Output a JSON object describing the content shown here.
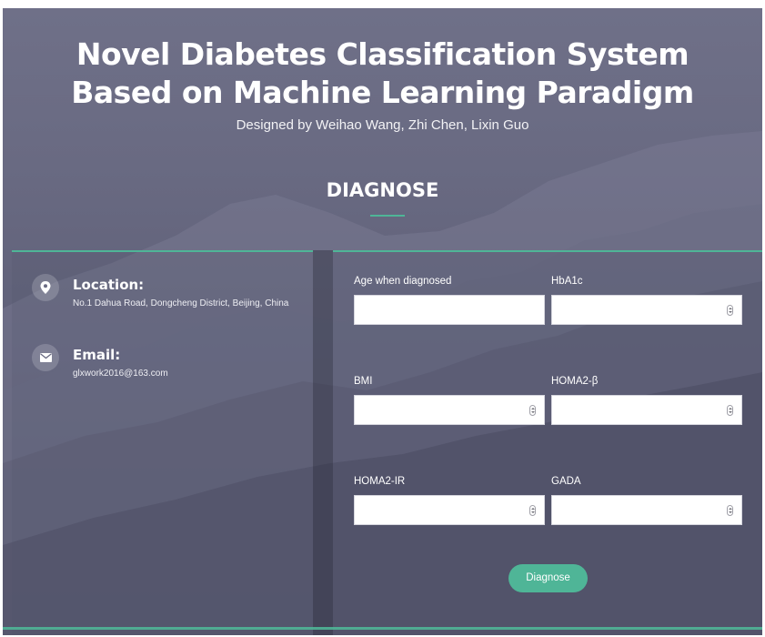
{
  "header": {
    "title_line1": "Novel Diabetes Classification System",
    "title_line2": "Based on Machine Learning Paradigm",
    "subtitle": "Designed by Weihao Wang, Zhi Chen, Lixin Guo"
  },
  "section": {
    "title": "DIAGNOSE"
  },
  "contact": {
    "location": {
      "icon": "map-pin-icon",
      "label": "Location:",
      "value": "No.1 Dahua Road, Dongcheng District, Beijing, China"
    },
    "email": {
      "icon": "envelope-icon",
      "label": "Email:",
      "value": "glxwork2016@163.com"
    }
  },
  "form": {
    "fields": [
      {
        "label": "Age when diagnosed",
        "value": "",
        "spinner": false
      },
      {
        "label": "HbA1c",
        "value": "",
        "spinner": true
      },
      {
        "label": "BMI",
        "value": "",
        "spinner": true
      },
      {
        "label": "HOMA2-β",
        "value": "",
        "spinner": true
      },
      {
        "label": "HOMA2-IR",
        "value": "",
        "spinner": true
      },
      {
        "label": "GADA",
        "value": "",
        "spinner": true
      }
    ],
    "submit_label": "Diagnose"
  },
  "colors": {
    "accent": "#4fb597",
    "background": "#63647c"
  }
}
